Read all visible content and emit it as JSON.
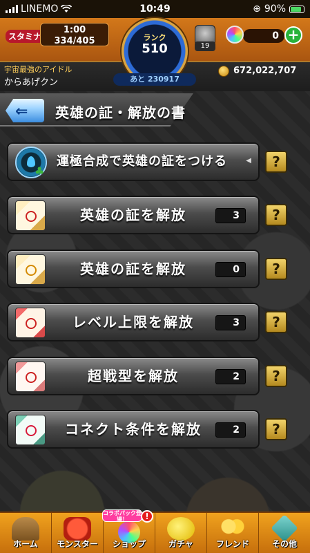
{
  "status_bar": {
    "carrier": "LINEMO",
    "time": "10:49",
    "battery": "90%"
  },
  "header": {
    "stamina_label": "スタミナ",
    "stamina_timer": "1:00",
    "stamina_value": "334/405",
    "rank_label": "ランク",
    "rank_value": "510",
    "rank_next": "あと 230917",
    "item_count": "19",
    "orb_count": "0",
    "plus_label": "+",
    "player_title": "宇宙最強のアイドル",
    "player_name": "からあげクン",
    "gold": "672,022,707"
  },
  "page": {
    "title": "英雄の証・解放の書",
    "back_label": "⇐"
  },
  "menu": [
    {
      "label": "運極合成で英雄の証をつける",
      "count": null,
      "help": "?"
    },
    {
      "label": "英雄の証を解放",
      "count": "3",
      "help": "?"
    },
    {
      "label": "英雄の証を解放",
      "count": "0",
      "help": "?"
    },
    {
      "label": "レベル上限を解放",
      "count": "3",
      "help": "?"
    },
    {
      "label": "超戦型を解放",
      "count": "2",
      "help": "?"
    },
    {
      "label": "コネクト条件を解放",
      "count": "2",
      "help": "?"
    }
  ],
  "bottom_nav": {
    "items": [
      {
        "label": "ホーム",
        "icon": "home-icon"
      },
      {
        "label": "モンスター",
        "icon": "monster-icon"
      },
      {
        "label": "ショップ",
        "icon": "shop-icon"
      },
      {
        "label": "ガチャ",
        "icon": "gacha-icon"
      },
      {
        "label": "フレンド",
        "icon": "friend-icon"
      },
      {
        "label": "その他",
        "icon": "other-icon"
      }
    ],
    "collab_badge": "コラボパック登場！",
    "alert": "!"
  }
}
